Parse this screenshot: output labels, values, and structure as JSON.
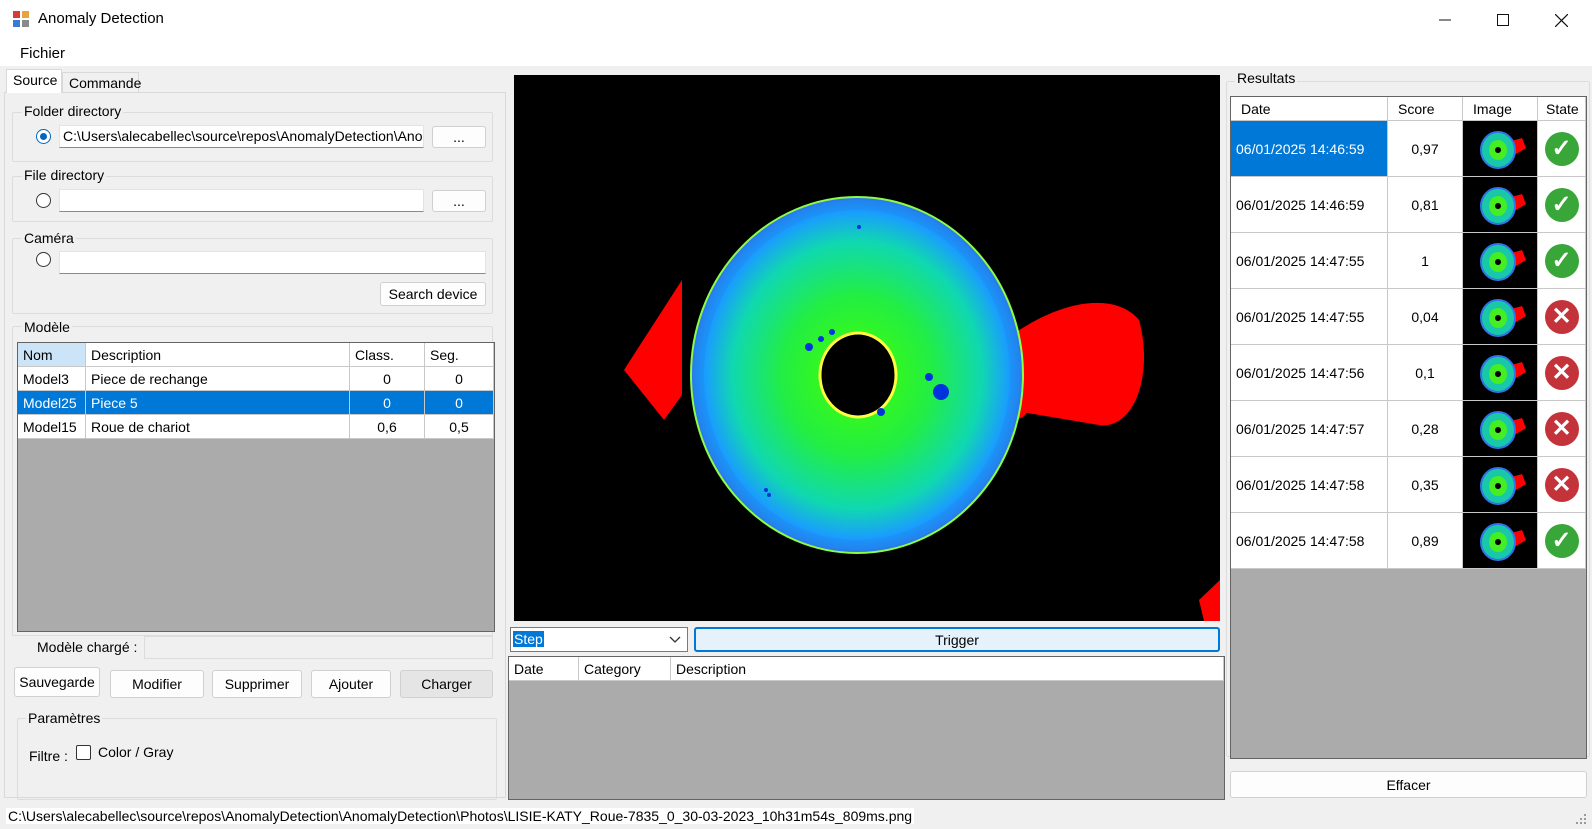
{
  "window": {
    "title": "Anomaly Detection"
  },
  "menu": {
    "items": [
      "Fichier"
    ]
  },
  "tabs": [
    "Source",
    "Commande"
  ],
  "source": {
    "folder_label": "Folder directory",
    "folder_path": "C:\\Users\\alecabellec\\source\\repos\\AnomalyDetection\\Anor",
    "browse_label": "...",
    "file_label": "File directory",
    "file_path": "",
    "camera_label": "Caméra",
    "camera_value": "",
    "search_device_label": "Search device"
  },
  "modele": {
    "label": "Modèle",
    "columns": [
      "Nom",
      "Description",
      "Class.",
      "Seg."
    ],
    "rows": [
      {
        "nom": "Model3",
        "description": "Piece de rechange",
        "class": "0",
        "seg": "0"
      },
      {
        "nom": "Model25",
        "description": "Piece 5",
        "class": "0",
        "seg": "0"
      },
      {
        "nom": "Model15",
        "description": "Roue de chariot",
        "class": "0,6",
        "seg": "0,5"
      }
    ],
    "selected_row": 1,
    "loaded_label": "Modèle chargé :",
    "loaded_value": "",
    "buttons": [
      "Sauvegarde",
      "Modifier",
      "Supprimer",
      "Ajouter",
      "Charger"
    ]
  },
  "parametres": {
    "label": "Paramètres",
    "filtre_label": "Filtre :",
    "color_gray_label": "Color / Gray",
    "color_gray_checked": false
  },
  "command": {
    "step_value": "Step",
    "trigger_label": "Trigger"
  },
  "log": {
    "columns": [
      "Date",
      "Category",
      "Description"
    ]
  },
  "resultats": {
    "label": "Resultats",
    "columns": [
      "Date",
      "Score",
      "Image",
      "State"
    ],
    "rows": [
      {
        "date": "06/01/2025 14:46:59",
        "score": "0,97",
        "state": "ok"
      },
      {
        "date": "06/01/2025 14:46:59",
        "score": "0,81",
        "state": "ok"
      },
      {
        "date": "06/01/2025 14:47:55",
        "score": "1",
        "state": "ok"
      },
      {
        "date": "06/01/2025 14:47:55",
        "score": "0,04",
        "state": "ko"
      },
      {
        "date": "06/01/2025 14:47:56",
        "score": "0,1",
        "state": "ko"
      },
      {
        "date": "06/01/2025 14:47:57",
        "score": "0,28",
        "state": "ko"
      },
      {
        "date": "06/01/2025 14:47:58",
        "score": "0,35",
        "state": "ko"
      },
      {
        "date": "06/01/2025 14:47:58",
        "score": "0,89",
        "state": "ok"
      }
    ],
    "selected_row": 0,
    "effacer_label": "Effacer"
  },
  "status": {
    "path": "C:\\Users\\alecabellec\\source\\repos\\AnomalyDetection\\AnomalyDetection\\Photos\\LISIE-KATY_Roue-7835_0_30-03-2023_10h31m54s_809ms.png"
  },
  "colors": {
    "selection": "#0078d7",
    "ok": "#38a638",
    "ko": "#c4323a",
    "grid_bg": "#ababab"
  }
}
